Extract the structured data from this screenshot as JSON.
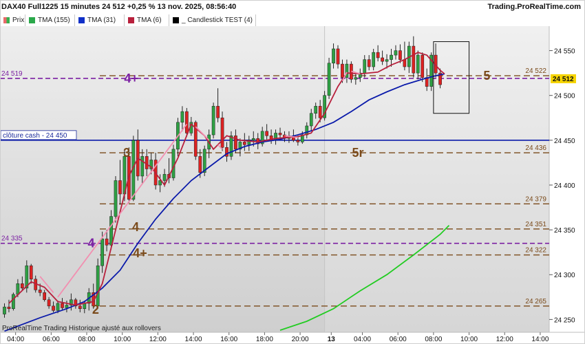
{
  "header": {
    "title": "DAX40 Full1225 15 minutes 24 512 +0,25 % 13 nov. 2025, 08:56:40",
    "source": "Trading.ProRealTime.com"
  },
  "indicators": [
    {
      "label": "Prix",
      "color": "#e89a7a",
      "icon": "price-candle-icon"
    },
    {
      "label": "TMA (155)",
      "color": "#2aa84a",
      "icon": "legend-swatch-icon"
    },
    {
      "label": "TMA (31)",
      "color": "#1030c8",
      "icon": "legend-swatch-icon"
    },
    {
      "label": "TMA (6)",
      "color": "#b8203c",
      "icon": "legend-swatch-icon"
    },
    {
      "label": "_ Candlestick TEST (4)",
      "color": "#000000",
      "icon": "legend-swatch-icon"
    }
  ],
  "footer": {
    "text": "ProRealTime Trading  Historique ajusté aux rollovers"
  },
  "colors": {
    "up": "#2ea043",
    "down": "#dd2222",
    "tma155": "#22cc22",
    "tma31": "#0a1aaa",
    "tma6": "#b8203c",
    "pink": "#f28fb0",
    "level": "#7a4a1a",
    "purple": "#7b1fa2",
    "cash": "#0a1aaa",
    "bg_left": "#d9d9d9",
    "bg_right": "#e2e2e2"
  },
  "chart_data": {
    "type": "candlestick",
    "title": "DAX40 Full1225 15 minutes",
    "last_price": "24 512",
    "ylim": [
      24238,
      24575
    ],
    "y_ticks": [
      24250,
      24300,
      24350,
      24400,
      24450,
      24500,
      24550
    ],
    "y_tick_labels": [
      "24 250",
      "24 300",
      "24 350",
      "24 400",
      "24 450",
      "24 500",
      "24 550"
    ],
    "x_labels": [
      {
        "t": 2.5,
        "label": "04:00"
      },
      {
        "t": 10.5,
        "label": "06:00"
      },
      {
        "t": 18.5,
        "label": "08:00"
      },
      {
        "t": 26.5,
        "label": "10:00"
      },
      {
        "t": 34.5,
        "label": "12:00"
      },
      {
        "t": 42.5,
        "label": "14:00"
      },
      {
        "t": 50.5,
        "label": "16:00"
      },
      {
        "t": 58.5,
        "label": "18:00"
      },
      {
        "t": 66.5,
        "label": "20:00"
      },
      {
        "t": 73.5,
        "label": "13",
        "bold": true
      },
      {
        "t": 80.5,
        "label": "04:00"
      },
      {
        "t": 88.5,
        "label": "06:00"
      },
      {
        "t": 96.5,
        "label": "08:00"
      },
      {
        "t": 104.5,
        "label": "10:00"
      },
      {
        "t": 112.5,
        "label": "12:00"
      },
      {
        "t": 120.5,
        "label": "14:00"
      }
    ],
    "session_break_t": 72,
    "levels": [
      {
        "value": 24522,
        "label": "24 522",
        "style": "dashed"
      },
      {
        "value": 24519,
        "label": "24 519",
        "style": "purple",
        "right_label": "24 512"
      },
      {
        "value": 24450,
        "label": "clôture cash -  24 450",
        "style": "solid"
      },
      {
        "value": 24436,
        "label": "24 436",
        "style": "dashed"
      },
      {
        "value": 24379,
        "label": "24 379",
        "style": "dashed"
      },
      {
        "value": 24351,
        "label": "24 351",
        "style": "dashed"
      },
      {
        "value": 24335,
        "label": "24 335",
        "style": "purple"
      },
      {
        "value": 24322,
        "label": "24 322",
        "style": "dashed"
      },
      {
        "value": 24265,
        "label": "24 265",
        "style": "dashed"
      }
    ],
    "annotations": [
      {
        "text": "4+",
        "t": 28.5,
        "v": 24519,
        "color": "purple"
      },
      {
        "text": "4",
        "t": 19.5,
        "v": 24335,
        "color": "purple"
      },
      {
        "text": "3",
        "t": 27.5,
        "v": 24436,
        "color": "level"
      },
      {
        "text": "5r",
        "t": 79.5,
        "v": 24436,
        "color": "level"
      },
      {
        "text": "4",
        "t": 29.5,
        "v": 24353,
        "color": "level"
      },
      {
        "text": "4+",
        "t": 30.5,
        "v": 24324,
        "color": "level"
      },
      {
        "text": "2",
        "t": 20.5,
        "v": 24261,
        "color": "level"
      },
      {
        "text": "5",
        "t": 108.5,
        "v": 24522,
        "color": "level"
      }
    ],
    "candles": [
      [
        24256,
        24268,
        24252,
        24264
      ],
      [
        24264,
        24272,
        24258,
        24262
      ],
      [
        24262,
        24280,
        24260,
        24278
      ],
      [
        24278,
        24295,
        24275,
        24290
      ],
      [
        24290,
        24298,
        24282,
        24285
      ],
      [
        24285,
        24316,
        24280,
        24310
      ],
      [
        24310,
        24312,
        24290,
        24295
      ],
      [
        24295,
        24299,
        24280,
        24283
      ],
      [
        24283,
        24290,
        24276,
        24280
      ],
      [
        24280,
        24283,
        24270,
        24272
      ],
      [
        24272,
        24275,
        24262,
        24265
      ],
      [
        24265,
        24270,
        24258,
        24260
      ],
      [
        24260,
        24271,
        24257,
        24268
      ],
      [
        24268,
        24274,
        24260,
        24263
      ],
      [
        24263,
        24271,
        24258,
        24266
      ],
      [
        24266,
        24279,
        24260,
        24272
      ],
      [
        24272,
        24274,
        24262,
        24265
      ],
      [
        24265,
        24272,
        24258,
        24262
      ],
      [
        24262,
        24271,
        24257,
        24268
      ],
      [
        24268,
        24285,
        24260,
        24280
      ],
      [
        24280,
        24290,
        24262,
        24265
      ],
      [
        24265,
        24318,
        24262,
        24310
      ],
      [
        24310,
        24348,
        24302,
        24340
      ],
      [
        24340,
        24350,
        24326,
        24333
      ],
      [
        24333,
        24372,
        24328,
        24365
      ],
      [
        24365,
        24410,
        24358,
        24405
      ],
      [
        24405,
        24428,
        24378,
        24390
      ],
      [
        24390,
        24440,
        24382,
        24432
      ],
      [
        24432,
        24442,
        24380,
        24384
      ],
      [
        24384,
        24455,
        24382,
        24450
      ],
      [
        24450,
        24462,
        24405,
        24410
      ],
      [
        24410,
        24440,
        24402,
        24432
      ],
      [
        24432,
        24440,
        24410,
        24418
      ],
      [
        24418,
        24436,
        24412,
        24428
      ],
      [
        24428,
        24436,
        24395,
        24400
      ],
      [
        24400,
        24412,
        24392,
        24405
      ],
      [
        24405,
        24418,
        24398,
        24412
      ],
      [
        24412,
        24430,
        24402,
        24408
      ],
      [
        24408,
        24445,
        24405,
        24440
      ],
      [
        24440,
        24475,
        24432,
        24470
      ],
      [
        24470,
        24488,
        24460,
        24482
      ],
      [
        24482,
        24486,
        24454,
        24458
      ],
      [
        24458,
        24476,
        24455,
        24470
      ],
      [
        24470,
        24472,
        24428,
        24432
      ],
      [
        24432,
        24440,
        24408,
        24414
      ],
      [
        24414,
        24444,
        24410,
        24440
      ],
      [
        24440,
        24462,
        24430,
        24456
      ],
      [
        24456,
        24492,
        24452,
        24488
      ],
      [
        24488,
        24508,
        24470,
        24475
      ],
      [
        24475,
        24482,
        24438,
        24442
      ],
      [
        24442,
        24448,
        24426,
        24432
      ],
      [
        24432,
        24460,
        24428,
        24455
      ],
      [
        24455,
        24462,
        24436,
        24440
      ],
      [
        24440,
        24452,
        24432,
        24448
      ],
      [
        24448,
        24458,
        24438,
        24445
      ],
      [
        24445,
        24455,
        24438,
        24450
      ],
      [
        24450,
        24460,
        24443,
        24452
      ],
      [
        24452,
        24458,
        24440,
        24446
      ],
      [
        24446,
        24465,
        24443,
        24460
      ],
      [
        24460,
        24468,
        24450,
        24455
      ],
      [
        24455,
        24462,
        24446,
        24450
      ],
      [
        24450,
        24462,
        24445,
        24458
      ],
      [
        24458,
        24464,
        24450,
        24456
      ],
      [
        24456,
        24460,
        24448,
        24452
      ],
      [
        24452,
        24460,
        24447,
        24455
      ],
      [
        24455,
        24462,
        24448,
        24450
      ],
      [
        24450,
        24455,
        24444,
        24448
      ],
      [
        24448,
        24460,
        24446,
        24456
      ],
      [
        24456,
        24470,
        24452,
        24466
      ],
      [
        24466,
        24485,
        24460,
        24480
      ],
      [
        24480,
        24492,
        24474,
        24488
      ],
      [
        24488,
        24495,
        24470,
        24475
      ],
      [
        24475,
        24505,
        24472,
        24500
      ],
      [
        24500,
        24542,
        24496,
        24536
      ],
      [
        24536,
        24558,
        24530,
        24552
      ],
      [
        24552,
        24556,
        24530,
        24535
      ],
      [
        24535,
        24540,
        24514,
        24520
      ],
      [
        24520,
        24540,
        24514,
        24535
      ],
      [
        24535,
        24538,
        24514,
        24518
      ],
      [
        24518,
        24524,
        24512,
        24520
      ],
      [
        24520,
        24530,
        24515,
        24525
      ],
      [
        24525,
        24545,
        24520,
        24540
      ],
      [
        24540,
        24545,
        24528,
        24532
      ],
      [
        24532,
        24552,
        24528,
        24548
      ],
      [
        24548,
        24556,
        24538,
        24542
      ],
      [
        24542,
        24550,
        24534,
        24538
      ],
      [
        24538,
        24546,
        24530,
        24540
      ],
      [
        24540,
        24552,
        24532,
        24545
      ],
      [
        24545,
        24556,
        24540,
        24550
      ],
      [
        24550,
        24557,
        24536,
        24540
      ],
      [
        24540,
        24560,
        24528,
        24532
      ],
      [
        24532,
        24560,
        24525,
        24555
      ],
      [
        24555,
        24566,
        24520,
        24525
      ],
      [
        24525,
        24550,
        24518,
        24545
      ],
      [
        24545,
        24548,
        24515,
        24520
      ],
      [
        24520,
        24530,
        24505,
        24510
      ],
      [
        24510,
        24548,
        24505,
        24545
      ],
      [
        24545,
        24558,
        24520,
        24525
      ],
      [
        24525,
        24530,
        24508,
        24512
      ]
    ],
    "tma6": [
      [
        1,
        24268
      ],
      [
        6,
        24292
      ],
      [
        9,
        24286
      ],
      [
        12,
        24270
      ],
      [
        16,
        24266
      ],
      [
        20,
        24270
      ],
      [
        22,
        24290
      ],
      [
        25,
        24350
      ],
      [
        28,
        24410
      ],
      [
        30,
        24430
      ],
      [
        33,
        24420
      ],
      [
        36,
        24400
      ],
      [
        39,
        24430
      ],
      [
        42,
        24468
      ],
      [
        45,
        24455
      ],
      [
        47,
        24440
      ],
      [
        50,
        24455
      ],
      [
        53,
        24450
      ],
      [
        57,
        24448
      ],
      [
        61,
        24452
      ],
      [
        66,
        24454
      ],
      [
        69,
        24458
      ],
      [
        72,
        24480
      ],
      [
        75,
        24510
      ],
      [
        77,
        24525
      ],
      [
        80,
        24524
      ],
      [
        84,
        24526
      ],
      [
        87,
        24534
      ],
      [
        90,
        24540
      ],
      [
        93,
        24548
      ],
      [
        95,
        24545
      ],
      [
        98,
        24528
      ],
      [
        99,
        24524
      ]
    ],
    "tma6_pink": [
      [
        8,
        24298
      ],
      [
        11,
        24280
      ],
      [
        12,
        24275
      ],
      [
        41,
        24468
      ],
      [
        43,
        24465
      ],
      [
        46,
        24450
      ],
      [
        48,
        24445
      ],
      [
        49,
        24440
      ],
      [
        63,
        24455
      ],
      [
        66,
        24453
      ],
      [
        76,
        24516
      ],
      [
        77,
        24526
      ],
      [
        78,
        24527
      ],
      [
        80,
        24524
      ]
    ],
    "tma31": [
      [
        0,
        24237
      ],
      [
        8,
        24252
      ],
      [
        14,
        24262
      ],
      [
        18,
        24270
      ],
      [
        22,
        24285
      ],
      [
        26,
        24305
      ],
      [
        30,
        24335
      ],
      [
        34,
        24362
      ],
      [
        38,
        24385
      ],
      [
        42,
        24405
      ],
      [
        46,
        24420
      ],
      [
        50,
        24435
      ],
      [
        54,
        24443
      ],
      [
        58,
        24448
      ],
      [
        62,
        24451
      ],
      [
        66,
        24456
      ],
      [
        70,
        24462
      ],
      [
        74,
        24470
      ],
      [
        78,
        24482
      ],
      [
        82,
        24495
      ],
      [
        86,
        24504
      ],
      [
        90,
        24512
      ],
      [
        94,
        24518
      ],
      [
        97,
        24522
      ],
      [
        99,
        24524
      ]
    ],
    "tma155": [
      [
        62,
        24238
      ],
      [
        68,
        24248
      ],
      [
        74,
        24262
      ],
      [
        80,
        24282
      ],
      [
        86,
        24300
      ],
      [
        92,
        24322
      ],
      [
        98,
        24345
      ],
      [
        100,
        24355
      ]
    ],
    "box": {
      "t0": 96.5,
      "t1": 104.5,
      "v0": 24480,
      "v1": 24560
    }
  }
}
